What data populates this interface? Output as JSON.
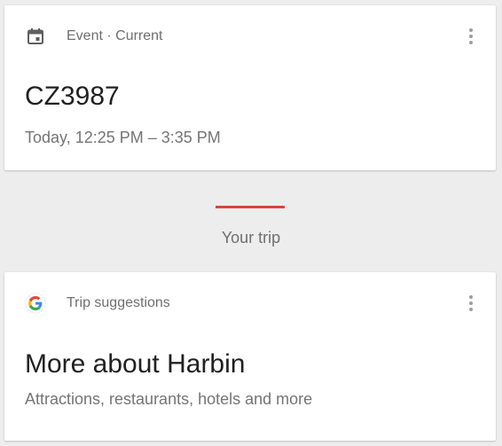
{
  "event_card": {
    "icon": "calendar-icon",
    "header_label": "Event · Current",
    "title": "CZ3987",
    "subtitle": "Today, 12:25 PM – 3:35 PM"
  },
  "section": {
    "accent_color": "#db4437",
    "label": "Your trip"
  },
  "trip_card": {
    "icon": "google-logo",
    "header_label": "Trip suggestions",
    "title": "More about Harbin",
    "subtitle": "Attractions, restaurants, hotels and more"
  }
}
